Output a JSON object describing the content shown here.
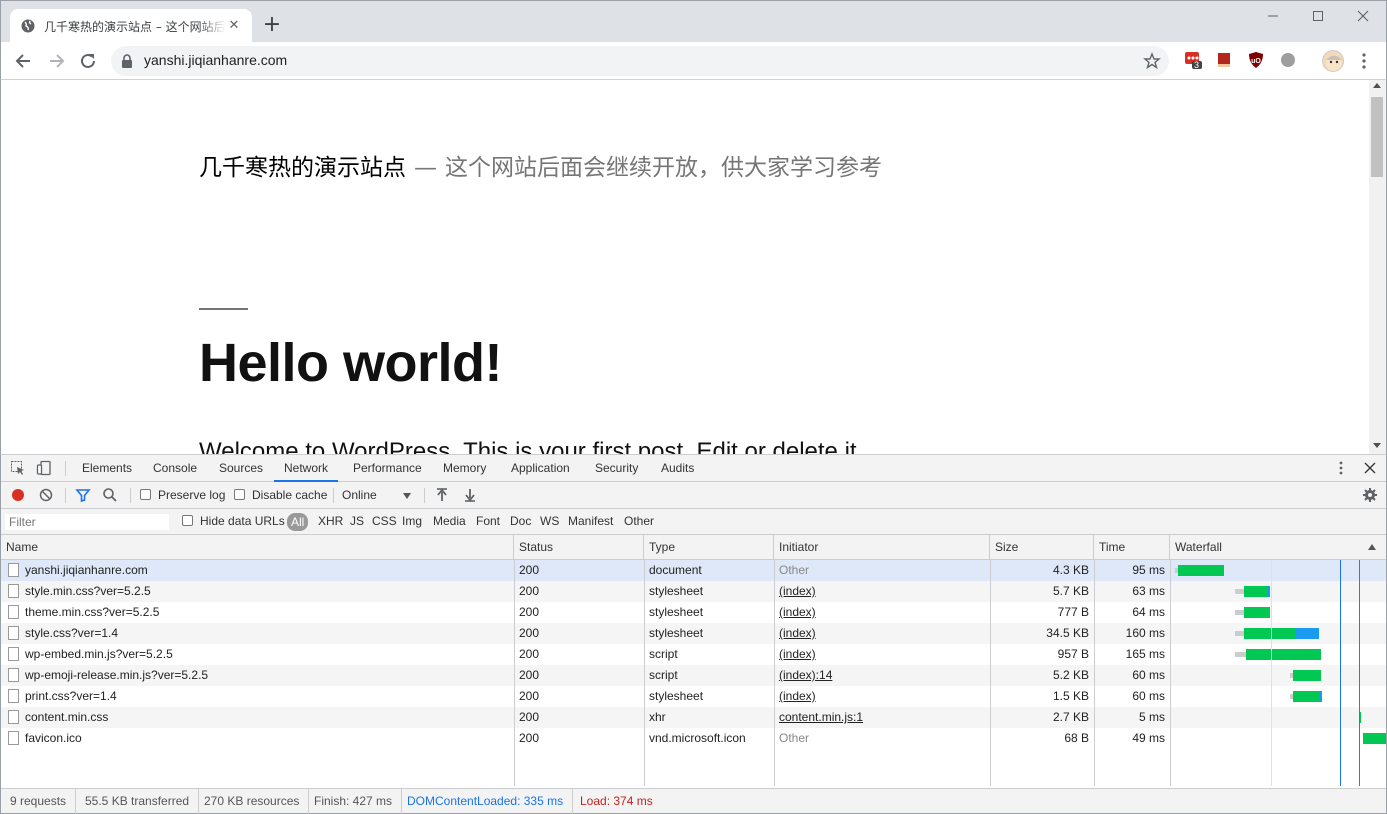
{
  "browser": {
    "tab_title": "几千寒热的演示站点 – 这个网站后面会继续开放，供大家学习参考",
    "url": "yanshi.jiqianhanre.com",
    "extension_badge": "3"
  },
  "page": {
    "site_name": "几千寒热的演示站点",
    "separator": "—",
    "site_description": "这个网站后面会继续开放，供大家学习参考",
    "post_title": "Hello world!",
    "post_excerpt": "Welcome to WordPress. This is your first post. Edit or delete it"
  },
  "devtools": {
    "tabs": [
      "Elements",
      "Console",
      "Sources",
      "Network",
      "Performance",
      "Memory",
      "Application",
      "Security",
      "Audits"
    ],
    "active_tab": "Network",
    "toolbar": {
      "preserve_log": "Preserve log",
      "disable_cache": "Disable cache",
      "throttle": "Online"
    },
    "filter": {
      "placeholder": "Filter",
      "hide_data_urls": "Hide data URLs",
      "types": [
        "All",
        "XHR",
        "JS",
        "CSS",
        "Img",
        "Media",
        "Font",
        "Doc",
        "WS",
        "Manifest",
        "Other"
      ]
    },
    "columns": [
      "Name",
      "Status",
      "Type",
      "Initiator",
      "Size",
      "Time",
      "Waterfall"
    ],
    "rows": [
      {
        "name": "yanshi.jiqianhanre.com",
        "status": "200",
        "type": "document",
        "initiator": "Other",
        "size": "4.3 KB",
        "time": "95 ms"
      },
      {
        "name": "style.min.css?ver=5.2.5",
        "status": "200",
        "type": "stylesheet",
        "initiator": "(index)",
        "size": "5.7 KB",
        "time": "63 ms"
      },
      {
        "name": "theme.min.css?ver=5.2.5",
        "status": "200",
        "type": "stylesheet",
        "initiator": "(index)",
        "size": "777 B",
        "time": "64 ms"
      },
      {
        "name": "style.css?ver=1.4",
        "status": "200",
        "type": "stylesheet",
        "initiator": "(index)",
        "size": "34.5 KB",
        "time": "160 ms"
      },
      {
        "name": "wp-embed.min.js?ver=5.2.5",
        "status": "200",
        "type": "script",
        "initiator": "(index)",
        "size": "957 B",
        "time": "165 ms"
      },
      {
        "name": "wp-emoji-release.min.js?ver=5.2.5",
        "status": "200",
        "type": "script",
        "initiator": "(index):14",
        "size": "5.2 KB",
        "time": "60 ms"
      },
      {
        "name": "print.css?ver=1.4",
        "status": "200",
        "type": "stylesheet",
        "initiator": "(index)",
        "size": "1.5 KB",
        "time": "60 ms"
      },
      {
        "name": "content.min.css",
        "status": "200",
        "type": "xhr",
        "initiator": "content.min.js:1",
        "size": "2.7 KB",
        "time": "5 ms"
      },
      {
        "name": "favicon.ico",
        "status": "200",
        "type": "vnd.microsoft.icon",
        "initiator": "Other",
        "size": "68 B",
        "time": "49 ms"
      }
    ],
    "summary": {
      "requests": "9 requests",
      "transferred": "55.5 KB transferred",
      "resources": "270 KB resources",
      "finish": "Finish: 427 ms",
      "dcl": "DOMContentLoaded: 335 ms",
      "load": "Load: 374 ms"
    },
    "colors": {
      "waterfall_download": "#00c853",
      "waterfall_waiting": "#1a9bf0",
      "dcl_line": "#1a73e8",
      "load_line": "#d14836"
    }
  }
}
